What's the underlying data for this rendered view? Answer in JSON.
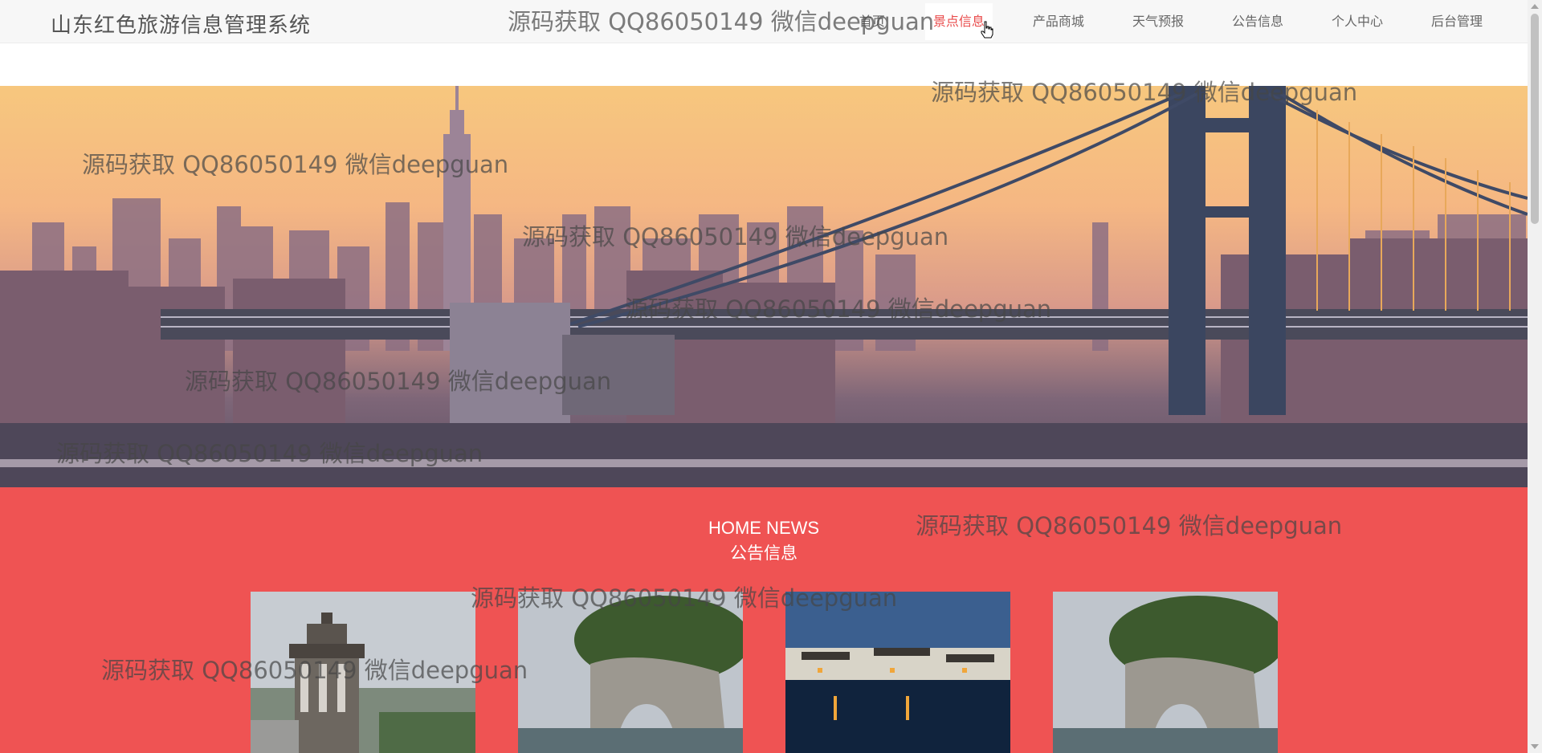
{
  "header": {
    "brand": "山东红色旅游信息管理系统",
    "nav": [
      {
        "label": "首页",
        "active": false
      },
      {
        "label": "景点信息",
        "active": true
      },
      {
        "label": "产品商城",
        "active": false
      },
      {
        "label": "天气预报",
        "active": false
      },
      {
        "label": "公告信息",
        "active": false
      },
      {
        "label": "个人中心",
        "active": false
      },
      {
        "label": "后台管理",
        "active": false
      }
    ]
  },
  "banner": {
    "indicator_count": 3,
    "active_index": 1
  },
  "news": {
    "title_en": "HOME NEWS",
    "title_cn": "公告信息"
  },
  "watermark": "源码获取 QQ86050149 微信deepguan",
  "colors": {
    "accent": "#e94b4b",
    "news_bg": "#ef5353"
  }
}
